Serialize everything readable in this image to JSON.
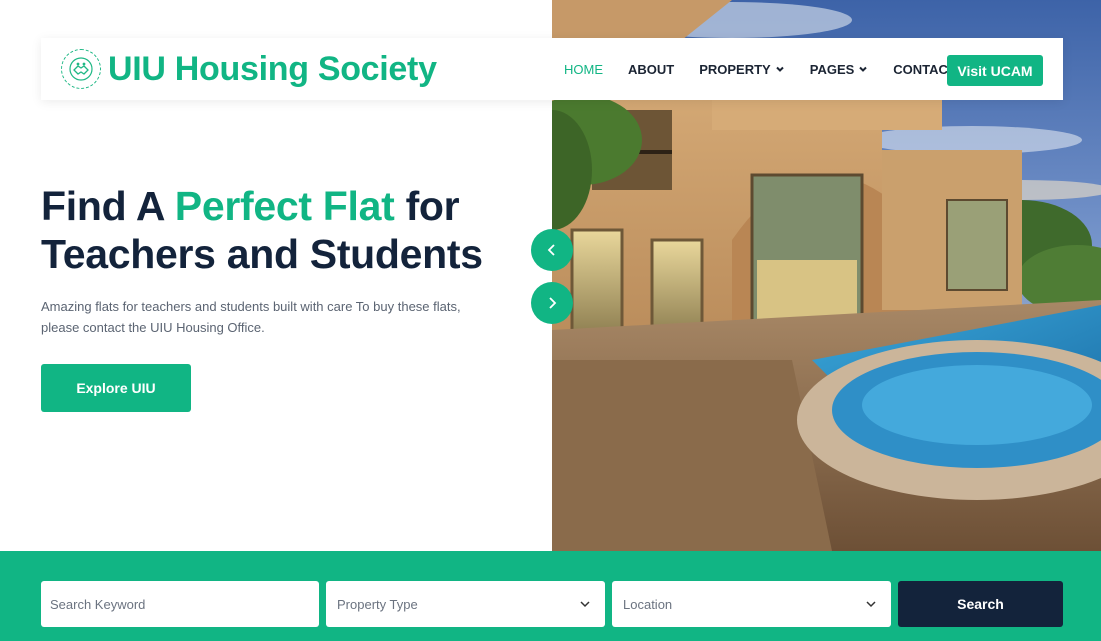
{
  "brand": {
    "name": "UIU Housing Society",
    "logo_icon": "handshake-emblem-icon",
    "color": "#11b584"
  },
  "nav": {
    "items": [
      {
        "label": "HOME",
        "active": true
      },
      {
        "label": "ABOUT",
        "active": false
      },
      {
        "label": "PROPERTY",
        "active": false,
        "dropdown": true
      },
      {
        "label": "PAGES",
        "active": false,
        "dropdown": true
      },
      {
        "label": "CONTACT",
        "active": false
      }
    ],
    "cta_label": "Visit UCAM"
  },
  "hero": {
    "title_part1": "Find A",
    "title_accent": "Perfect Flat",
    "title_part2": "for",
    "title_line2": "Teachers and Students",
    "description": "Amazing flats for teachers and students built with care To buy these flats, please contact the UIU Housing Office.",
    "button_label": "Explore UIU",
    "image": "villa-with-pool-photo"
  },
  "carousel": {
    "prev_icon": "chevron-left-icon",
    "next_icon": "chevron-right-icon"
  },
  "search": {
    "keyword_placeholder": "Search Keyword",
    "property_type": "Property Type",
    "location": "Location",
    "button_label": "Search"
  },
  "colors": {
    "accent": "#11b584",
    "dark": "#13233b",
    "text": "#1b2433"
  }
}
